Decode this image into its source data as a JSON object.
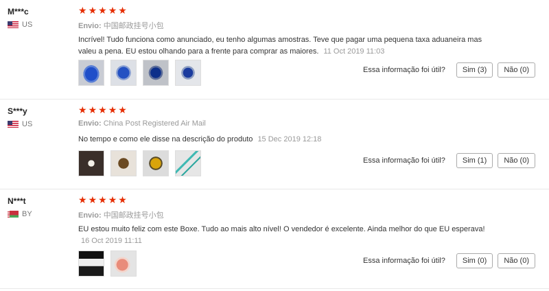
{
  "labels": {
    "shipping": "Envio:",
    "helpful_question": "Essa informação foi útil?",
    "star_icon": "★"
  },
  "reviews": [
    {
      "user": "M***c",
      "country": "US",
      "flag": "us-flag",
      "stars": 5,
      "shipping_method": "中国邮政挂号小包",
      "text": "Incrível! Tudo funciona como anunciado, eu tenho algumas amostras. Teve que pagar uma pequena taxa aduaneira mas valeu a pena. EU estou olhando para a frente para comprar as maiores.",
      "date": "11 Oct 2019 11:03",
      "yes_label": "Sim (3)",
      "no_label": "Não (0)"
    },
    {
      "user": "S***y",
      "country": "US",
      "flag": "us-flag",
      "stars": 5,
      "shipping_method": "China Post Registered Air Mail",
      "text": "No tempo e como ele disse na descrição do produto",
      "date": "15 Dec 2019 12:18",
      "yes_label": "Sim (1)",
      "no_label": "Não (0)"
    },
    {
      "user": "N***t",
      "country": "BY",
      "flag": "by-flag",
      "stars": 5,
      "shipping_method": "中国邮政挂号小包",
      "text": "EU estou muito feliz com este Boxe. Tudo ao mais alto nível! O vendedor é excelente. Ainda melhor do que EU esperava!",
      "date": "16 Oct 2019 11:11",
      "yes_label": "Sim (0)",
      "no_label": "Não (0)"
    }
  ],
  "colors": {
    "star": "#e62e04",
    "muted_text": "#999999",
    "divider": "#e8e8e8"
  }
}
